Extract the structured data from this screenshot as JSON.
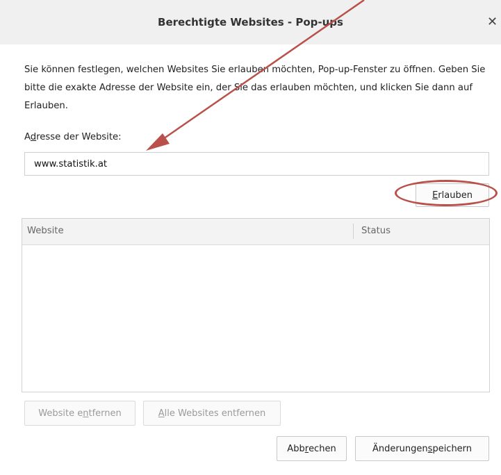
{
  "dialog": {
    "title": "Berechtigte Websites - Pop-ups",
    "close_glyph": "✕",
    "description": "Sie können festlegen, welchen Websites Sie erlauben möchten, Pop-up-Fenster zu öffnen. Geben Sie bitte die exakte Adresse der Website ein, der Sie das erlauben möchten, und klicken Sie dann auf Erlauben.",
    "address_label_pre": "A",
    "address_label_key": "d",
    "address_label_post": "resse der Website:",
    "address_value": "www.statistik.at",
    "allow_button_key": "E",
    "allow_button_post": "rlauben",
    "table": {
      "columns": [
        "Website",
        "Status"
      ],
      "rows": []
    },
    "remove_button_pre": "Website e",
    "remove_button_key": "n",
    "remove_button_post": "tfernen",
    "remove_all_button_key": "A",
    "remove_all_button_post": "lle Websites entfernen",
    "cancel_button_pre": "Abb",
    "cancel_button_key": "r",
    "cancel_button_post": "echen",
    "save_button_pre": "Änderungen ",
    "save_button_key": "s",
    "save_button_post": "peichern"
  },
  "annotation": {
    "arrow_color": "#b9504b",
    "highlight_color": "#b9504b"
  }
}
